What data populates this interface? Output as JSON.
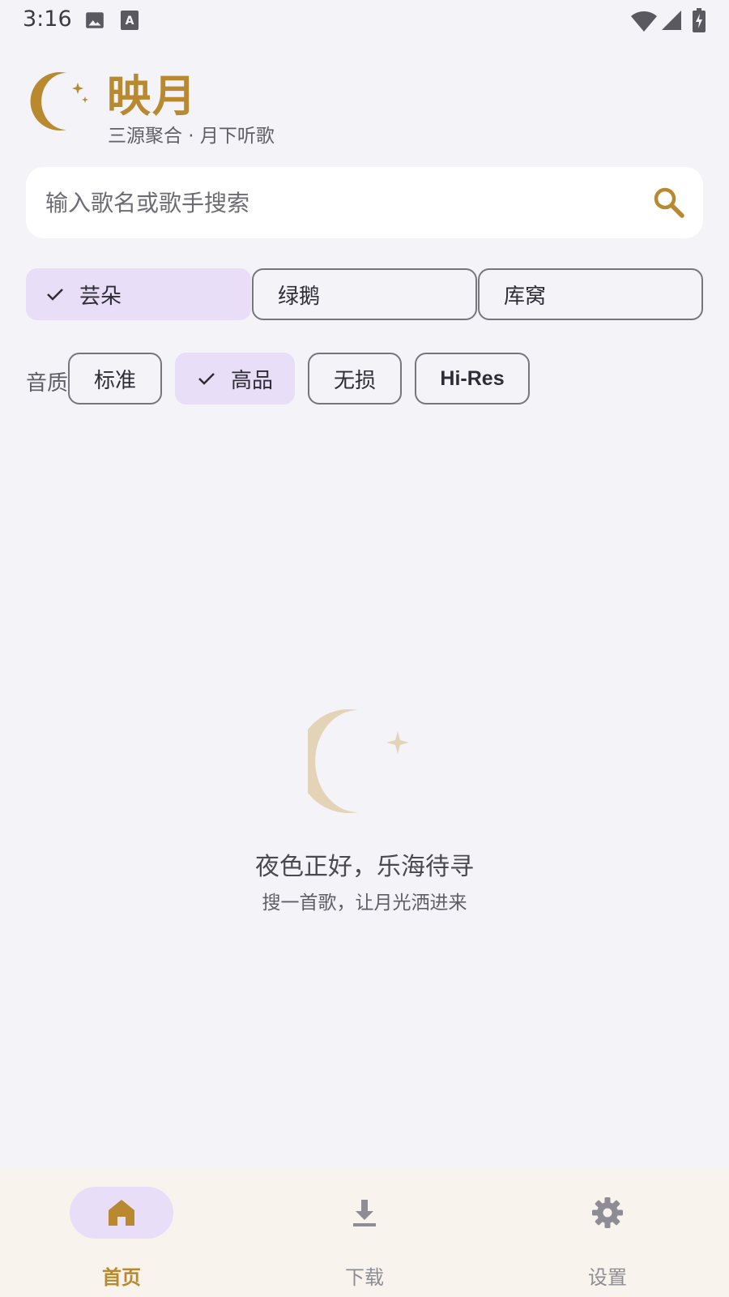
{
  "status_bar": {
    "time": "3:16",
    "icons": [
      "image-icon",
      "text-a-icon",
      "wifi-icon",
      "signal-icon",
      "battery-charging-icon"
    ]
  },
  "header": {
    "title": "映月",
    "subtitle": "三源聚合 · 月下听歌",
    "logo_icon": "moon-stars-icon"
  },
  "search": {
    "placeholder": "输入歌名或歌手搜索",
    "value": "",
    "icon": "search-icon"
  },
  "sources": [
    {
      "label": "芸朵",
      "selected": true
    },
    {
      "label": "绿鹅",
      "selected": false
    },
    {
      "label": "库窝",
      "selected": false
    }
  ],
  "quality": {
    "label": "音质",
    "options": [
      {
        "label": "标准",
        "selected": false
      },
      {
        "label": "高品",
        "selected": true
      },
      {
        "label": "无损",
        "selected": false
      },
      {
        "label": "Hi-Res",
        "selected": false
      }
    ]
  },
  "empty_state": {
    "icon": "moon-star-icon",
    "title": "夜色正好，乐海待寻",
    "subtitle": "搜一首歌，让月光洒进来"
  },
  "bottom_nav": [
    {
      "label": "首页",
      "icon": "home-icon",
      "active": true
    },
    {
      "label": "下载",
      "icon": "download-icon",
      "active": false
    },
    {
      "label": "设置",
      "icon": "settings-gear-icon",
      "active": false
    }
  ],
  "colors": {
    "accent": "#b8892e",
    "selected_bg": "#e8def8",
    "background": "#f4f3f8",
    "nav_background": "#f8f3ec",
    "moon_faded": "#e3d4b8"
  }
}
